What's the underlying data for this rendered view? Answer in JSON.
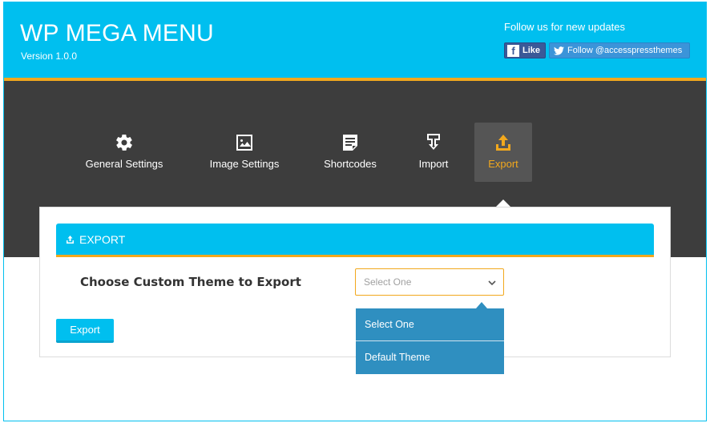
{
  "header": {
    "title": "WP MEGA MENU",
    "version": "Version 1.0.0",
    "follow_text": "Follow us for new updates",
    "facebook_label": "Like",
    "twitter_label": "Follow @accesspressthemes"
  },
  "nav": {
    "items": [
      {
        "label": "General Settings",
        "icon": "gear-icon"
      },
      {
        "label": "Image Settings",
        "icon": "image-icon"
      },
      {
        "label": "Shortcodes",
        "icon": "document-icon"
      },
      {
        "label": "Import",
        "icon": "import-icon"
      },
      {
        "label": "Export",
        "icon": "export-icon",
        "active": true
      }
    ]
  },
  "export_section": {
    "title": "EXPORT",
    "field_label": "Choose Custom Theme to Export",
    "select_placeholder": "Select One",
    "options": [
      "Select One",
      "Default Theme"
    ],
    "button_label": "Export"
  },
  "colors": {
    "primary": "#00bfef",
    "accent": "#f2a81d",
    "dark": "#3d3d3d",
    "dropdown": "#2f8fc0",
    "facebook": "#3b5998",
    "twitter": "#3b94d9"
  }
}
